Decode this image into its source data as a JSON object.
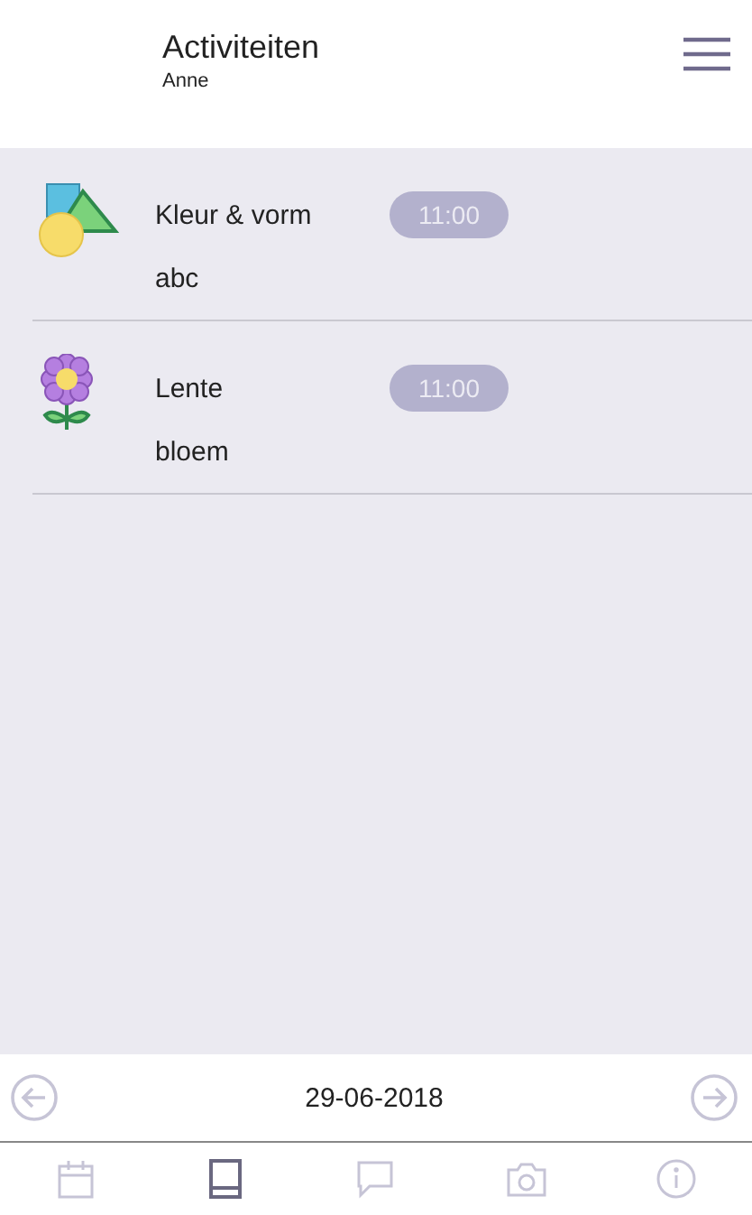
{
  "header": {
    "title": "Activiteiten",
    "subtitle": "Anne"
  },
  "activities": [
    {
      "kind": "shapes",
      "name": "Kleur & vorm",
      "time": "11:00",
      "note": "abc"
    },
    {
      "kind": "flower",
      "name": "Lente",
      "time": "11:00",
      "note": "bloem"
    }
  ],
  "date_bar": {
    "date": "29-06-2018"
  },
  "tabs": [
    {
      "kind": "calendar",
      "selected": false
    },
    {
      "kind": "book",
      "selected": true
    },
    {
      "kind": "chat",
      "selected": false
    },
    {
      "kind": "camera",
      "selected": false
    },
    {
      "kind": "info",
      "selected": false
    }
  ]
}
